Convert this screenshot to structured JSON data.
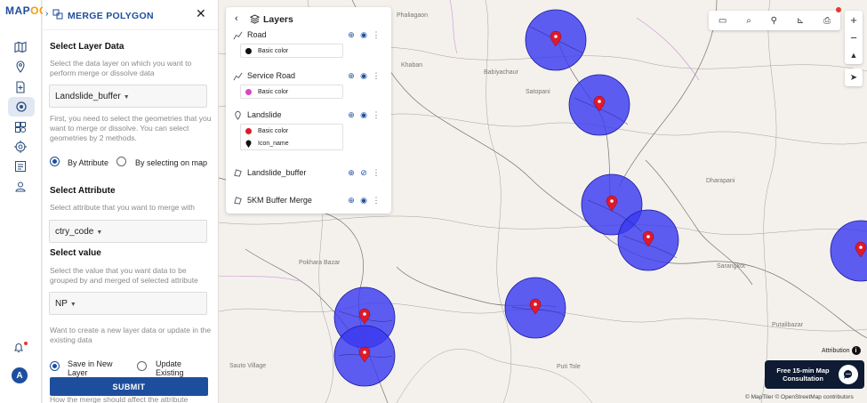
{
  "app": {
    "logo_main": "MAP",
    "logo_accent": "OG"
  },
  "rail": {
    "items": [
      {
        "name": "map-icon"
      },
      {
        "name": "location-icon"
      },
      {
        "name": "add-file-icon"
      },
      {
        "name": "gis-tools-icon",
        "active": true
      },
      {
        "name": "layers-grid-icon"
      },
      {
        "name": "target-icon"
      },
      {
        "name": "list-icon"
      },
      {
        "name": "user-group-icon"
      }
    ],
    "avatar_initial": "A"
  },
  "tool": {
    "title": "MERGE POLYGON",
    "select_layer_title": "Select Layer Data",
    "select_layer_hint": "Select the data layer on which you want to perform merge or dissolve data",
    "layer_value": "Landslide_buffer",
    "geometry_hint": "First, you need to select the geometries that you want to merge or dissolve. You can select geometries by 2 methods.",
    "method_by_attribute": "By Attribute",
    "method_by_map": "By selecting on map",
    "select_attribute_title": "Select Attribute",
    "select_attribute_hint": "Select attribute that you want to merge with",
    "attribute_value": "ctry_code",
    "select_value_title": "Select value",
    "select_value_hint": "Select the value that you want data to be grouped by and merged of selected attribute",
    "value_value": "NP",
    "output_hint": "Want to create a new layer data or update in the existing data",
    "save_new_label": "Save in New Layer",
    "update_existing_label": "Update Existing",
    "submit_label": "SUBMIT",
    "merge_hint": "How the merge should affect the attribute"
  },
  "layers": {
    "title": "Layers",
    "items": [
      {
        "name": "Road",
        "styles": [
          {
            "label": "Basic color",
            "color": "#111111"
          }
        ]
      },
      {
        "name": "Service Road",
        "styles": [
          {
            "label": "Basic color",
            "color": "#d946c8"
          }
        ]
      },
      {
        "name": "Landslide",
        "styles": [
          {
            "label": "Basic color",
            "color": "#e0192b"
          },
          {
            "label": "Icon_name",
            "color": "#111111"
          }
        ]
      },
      {
        "name": "Landslide_buffer",
        "styles": []
      },
      {
        "name": "5KM Buffer Merge",
        "styles": []
      }
    ]
  },
  "map": {
    "places": [
      "Phaliagaon",
      "Khaban",
      "Babiyachaur",
      "Satopani",
      "Dharapani",
      "Pokhara Bazar",
      "Sauto Village",
      "Puti Tole",
      "Putalibazar",
      "Sarangkot"
    ],
    "buffer_color": "#3b3bf0",
    "marker_color": "#e0192b",
    "attribution_label": "Attribution",
    "consult_label": "Free 15-min Map Consultation",
    "credits": "© MapTiler © OpenStreetMap contributors"
  }
}
